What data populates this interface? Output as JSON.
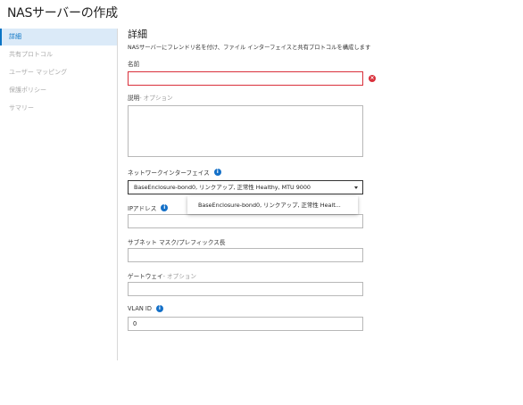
{
  "page": {
    "title": "NASサーバーの作成"
  },
  "sidebar": {
    "items": [
      {
        "label": "詳細"
      },
      {
        "label": "共有プロトコル"
      },
      {
        "label": "ユーザー マッピング"
      },
      {
        "label": "保護ポリシー"
      },
      {
        "label": "サマリー"
      }
    ]
  },
  "main": {
    "heading": "詳細",
    "description": "NASサーバーにフレンドリ名を付け、ファイル インターフェイスと共有プロトコルを構成します",
    "name": {
      "label": "名前",
      "value": ""
    },
    "description_field": {
      "label": "説明",
      "optional": " - オプション",
      "value": ""
    },
    "network_interface": {
      "label": "ネットワークインターフェイス",
      "selected": "BaseEnclosure-bond0, リンクアップ, 正常性 Healthy, MTU 9000",
      "option": "BaseEnclosure-bond0, リンクアップ, 正常性 Healt..."
    },
    "ip_address": {
      "label": "IPアドレス",
      "value": ""
    },
    "subnet": {
      "label": "サブネット マスク/プレフィックス長",
      "value": ""
    },
    "gateway": {
      "label": "ゲートウェイ",
      "optional": " - オプション",
      "value": ""
    },
    "vlan": {
      "label": "VLAN ID",
      "value": "0"
    }
  },
  "icons": {
    "info": "i",
    "error": "×"
  },
  "colors": {
    "accent": "#0a74c4",
    "error": "#d9303b",
    "sidebar_active_bg": "#dbeaf8"
  }
}
